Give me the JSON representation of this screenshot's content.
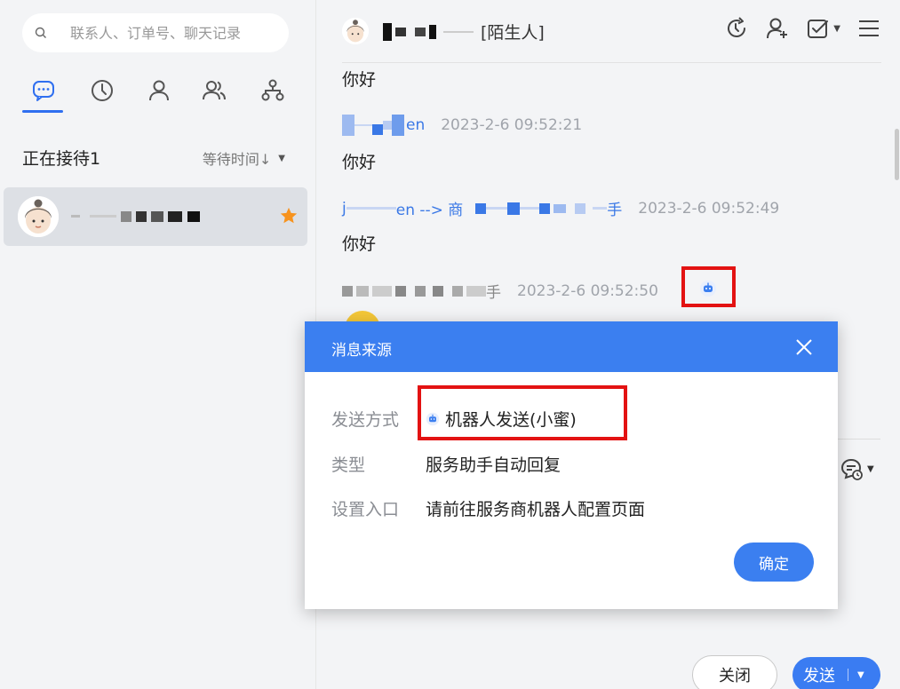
{
  "search": {
    "placeholder": "联系人、订单号、聊天记录"
  },
  "tabs": [
    {
      "icon": "chat-bubble-icon",
      "active": true
    },
    {
      "icon": "clock-icon"
    },
    {
      "icon": "person-icon"
    },
    {
      "icon": "group-icon"
    },
    {
      "icon": "org-tree-icon"
    }
  ],
  "queue": {
    "title": "正在接待1",
    "sort_label": "等待时间↓"
  },
  "contacts": [
    {
      "name": "",
      "starred": true
    }
  ],
  "chat": {
    "title_suffix": "[陌生人]",
    "messages": [
      {
        "text": "你好"
      },
      {
        "sender_suffix": "en",
        "time": "2023-2-6 09:52:21",
        "text": "你好"
      },
      {
        "sender_prefix": "j",
        "sender_mid": "en --> 商",
        "sender_tail": "手",
        "time": "2023-2-6 09:52:49",
        "text": "你好"
      },
      {
        "sender_tail": "手",
        "time": "2023-2-6 09:52:50"
      }
    ]
  },
  "buttons": {
    "close": "关闭",
    "send": "发送"
  },
  "modal": {
    "title": "消息来源",
    "rows": [
      {
        "label": "发送方式",
        "value": "机器人发送(小蜜)"
      },
      {
        "label": "类型",
        "value": "服务助手自动回复"
      },
      {
        "label": "设置入口",
        "value": "请前往服务商机器人配置页面"
      }
    ],
    "confirm": "确定"
  },
  "colors": {
    "accent": "#3b7ff0",
    "highlight": "#e31212",
    "star": "#f7931e"
  }
}
